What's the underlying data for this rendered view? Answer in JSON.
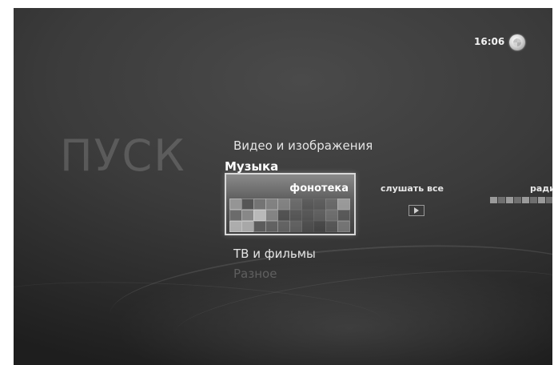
{
  "status": {
    "clock": "16:06"
  },
  "start": {
    "title": "ПУСК"
  },
  "menu": {
    "video": "Видео и изображения",
    "music": "Музыка",
    "tv": "ТВ и фильмы",
    "other": "Разное"
  },
  "music_strip": {
    "library": "фонотека",
    "play_all": "слушать все",
    "radio": "ради"
  },
  "icons": {
    "logo": "media-center-logo-icon",
    "play": "play-icon"
  }
}
